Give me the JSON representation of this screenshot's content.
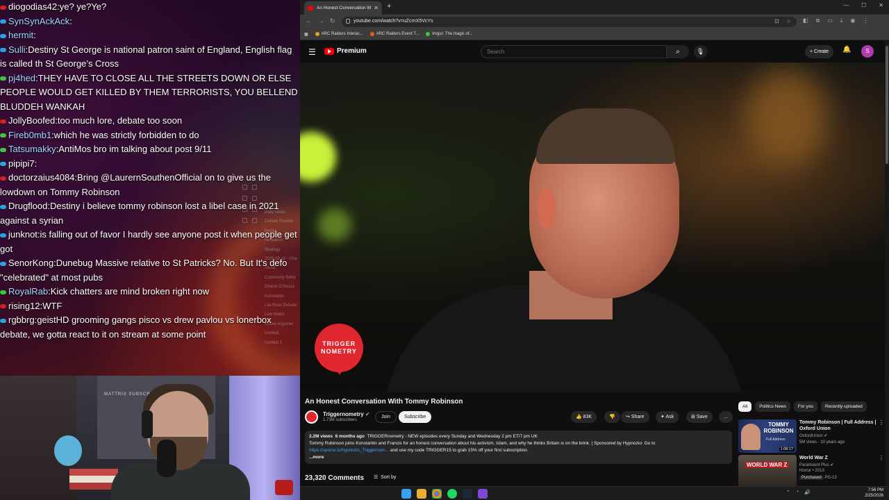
{
  "chat": {
    "messages": [
      {
        "user": "diogodias42",
        "badge_color": "#cc2222",
        "user_color": "#ffffff",
        "text": "ye? ye?Ye?"
      },
      {
        "user": "SynSynAckAck",
        "badge_color": "#2aa3e0",
        "user_color": "#a0d8ff",
        "text": ""
      },
      {
        "user": "hermit",
        "badge_color": "#2aa3e0",
        "user_color": "#a0d8ff",
        "text": ""
      },
      {
        "user": "Sulli",
        "badge_color": "#2aa3e0",
        "user_color": "#a0d8ff",
        "text": "Destiny St George is national patron saint of England, English flag is called th St George’s Cross"
      },
      {
        "user": "pj4hed",
        "badge_color": "#3ec43e",
        "user_color": "#a0d8ff",
        "text": "THEY HAVE TO CLOSE ALL THE STREETS DOWN OR ELSE PEOPLE WOULD GET KILLED BY THEM TERRORISTS, YOU BELLEND BLUDDEH WANKAH"
      },
      {
        "user": "JollyBoofed",
        "badge_color": "#cc2222",
        "user_color": "#ffffff",
        "text": "too much lore, debate too soon"
      },
      {
        "user": "Fireb0mb1",
        "badge_color": "#3ec43e",
        "user_color": "#a0d8ff",
        "text": "which he was strictly forbidden to do"
      },
      {
        "user": "Tatsumakky",
        "badge_color": "#3ec43e",
        "user_color": "#a0d8ff",
        "text": "AntiMos bro im talking about post 9/11"
      },
      {
        "user": "pipipi7",
        "badge_color": "#2aa3e0",
        "user_color": "#ffffff",
        "text": ""
      },
      {
        "user": "doctorzaius4084",
        "badge_color": "#cc2222",
        "user_color": "#ffffff",
        "text": "Bring @LaurernSouthenOfficial on to give us the lowdown on Tommy Robinson"
      },
      {
        "user": "Drugflood",
        "badge_color": "#2aa3e0",
        "user_color": "#ffffff",
        "text": "Destiny i believe tommy robinson lost a libel case in 2021 against a syrian"
      },
      {
        "user": "junknot",
        "badge_color": "#2aa3e0",
        "user_color": "#ffffff",
        "text": "is falling out of favor I hardly see anyone post it when people get got"
      },
      {
        "user": "SenorKong",
        "badge_color": "#2aa3e0",
        "user_color": "#ffffff",
        "text": "Dunebug Massive relative to St Patricks? No. But It's defo \"celebrated\" at most pubs"
      },
      {
        "user": "RoyalRab",
        "badge_color": "#3ec43e",
        "user_color": "#a0d8ff",
        "text": "Kick chatters are mind broken right now"
      },
      {
        "user": "rising12",
        "badge_color": "#cc2222",
        "user_color": "#ffffff",
        "text": "WTF"
      },
      {
        "user": "rgbbrg",
        "badge_color": "#2aa3e0",
        "user_color": "#ffffff",
        "text": "geistHD grooming gangs pisco vs drew pavlou vs lonerbox debate, we gotta react to it on stream at some point"
      }
    ],
    "ghost_tree": [
      "Daily News",
      "Debate Review",
      "Media",
      "Research",
      "Strategy",
      "2025.09.10 - Cha",
      "About",
      "Commonly Refer",
      "Dinesh D'Souza",
      "Konstantin",
      "Lila Rose Debate",
      "Live Notes",
      "ositive Argumer",
      "Untitled",
      "Untitled 1"
    ]
  },
  "webcam": {
    "wall_text": "MATTRIX SUBSCRIB"
  },
  "browser": {
    "tab_title": "An Honest Conversation With T",
    "url": "youtube.com/watch?v=uZcrnX5VcYs",
    "bookmarks": [
      {
        "label": "ARC Raiders Interac...",
        "color": "#e0a020"
      },
      {
        "label": "ARC Raiders Event T...",
        "color": "#e06020"
      },
      {
        "label": "Imgur: The magic of...",
        "color": "#3ec43e"
      }
    ]
  },
  "youtube": {
    "brand": "Premium",
    "search_placeholder": "Search",
    "create_label": "Create",
    "avatar_letter": "S",
    "video": {
      "logo_line1": "TRIGGER",
      "logo_line2": "NOMETRY",
      "title": "An Honest Conversation With Tommy Robinson"
    },
    "channel": {
      "name": "Triggernometry",
      "subscribers": "1.73M subscribers",
      "join_label": "Join",
      "subscribe_label": "Subscribe"
    },
    "actions": {
      "likes": "83K",
      "share": "Share",
      "ask": "Ask",
      "save": "Save",
      "more": "..."
    },
    "description": {
      "views": "2.2M views",
      "age": "6 months ago",
      "line1_rest": "TRIGGERnometry - NEW episodes every Sunday and Wednesday 2 pm ET/7 pm UK",
      "line2": "Tommy Robinson joins Konstantin and Francis for an honest conversation about his activism, Islam, and why he thinks Britain is on the brink. | Sponsored by Hypnozio: Go to",
      "link": "https://sponsr.is/hypnozio_Triggernom...",
      "line3_rest": "and use my code TRIGGER15 to grab 15% off your first subscription.",
      "more": "...more"
    },
    "comments": {
      "count": "23,320 Comments",
      "sort": "Sort by"
    },
    "chips": [
      "All",
      "Politics News",
      "For you",
      "Recently uploaded"
    ],
    "recommendations": [
      {
        "title": "Tommy Robinson | Full Address | Oxford Union",
        "channel": "OxfordUnion",
        "meta": "5M views · 10 years ago",
        "duration": "1:08:17",
        "thumb_text": "TOMMY ROBINSON",
        "thumb_sub": "Full Address"
      },
      {
        "title": "World War Z",
        "channel": "Paramount Plus",
        "meta": "Horror • 2013",
        "purchased": "Purchased",
        "rating": "PG-13",
        "thumb_text": "WORLD WAR Z"
      }
    ]
  },
  "taskbar": {
    "time": "7:56 PM",
    "date": "2/25/2026"
  }
}
